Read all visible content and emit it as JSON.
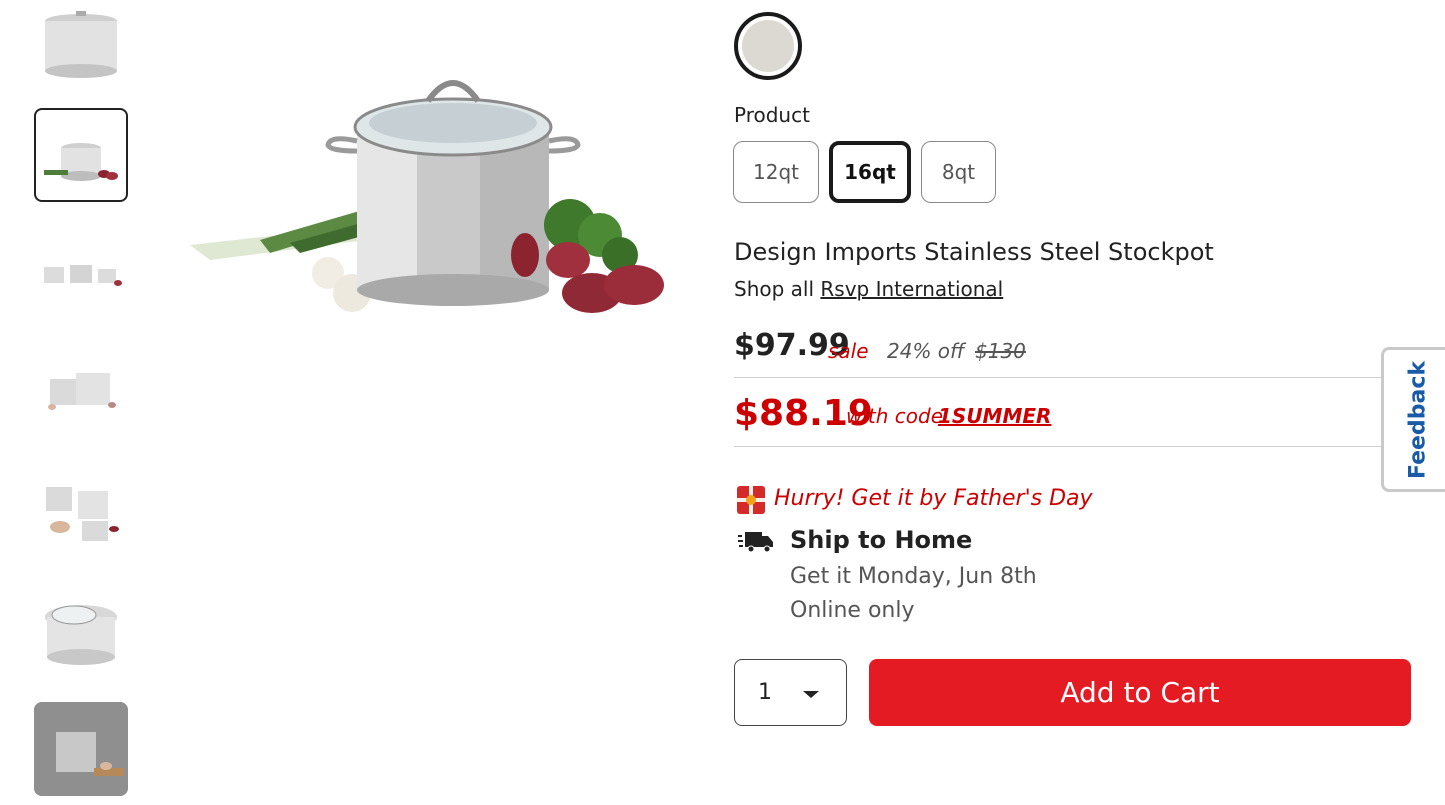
{
  "gallery": {
    "thumbnails": [
      {
        "name": "stockpot-front"
      },
      {
        "name": "stockpot-with-vegetables",
        "selected": true
      },
      {
        "name": "stockpot-set-lineup"
      },
      {
        "name": "stockpot-set-stacked"
      },
      {
        "name": "stockpot-set-with-lids"
      },
      {
        "name": "stockpot-with-lid-open"
      },
      {
        "name": "stockpot-lifestyle"
      }
    ]
  },
  "color_swatch": {
    "color": "#dcd9d2"
  },
  "product": {
    "label": "Product",
    "sizes": [
      {
        "label": "12qt",
        "selected": false
      },
      {
        "label": "16qt",
        "selected": true
      },
      {
        "label": "8qt",
        "selected": false
      }
    ],
    "title": "Design Imports Stainless Steel Stockpot",
    "shop_all_prefix": "Shop all",
    "brand": "Rsvp International"
  },
  "pricing": {
    "price": "$97.99",
    "sale_label": "sale",
    "percent_off": "24% off",
    "original_price": "$130",
    "code_price": "$88.19",
    "with_code": "with code",
    "promo_code": "1SUMMER"
  },
  "delivery": {
    "hurry": "Hurry! Get it by Father's Day",
    "ship_title": "Ship to Home",
    "ship_date": "Get it Monday, Jun 8th",
    "ship_note": "Online only"
  },
  "cart": {
    "quantity": "1",
    "add_label": "Add to Cart"
  },
  "feedback": {
    "label": "Feedback"
  },
  "colors": {
    "accent_red": "#e51b23",
    "sale_red": "#cc0000",
    "feedback_blue": "#1a5ba8"
  }
}
